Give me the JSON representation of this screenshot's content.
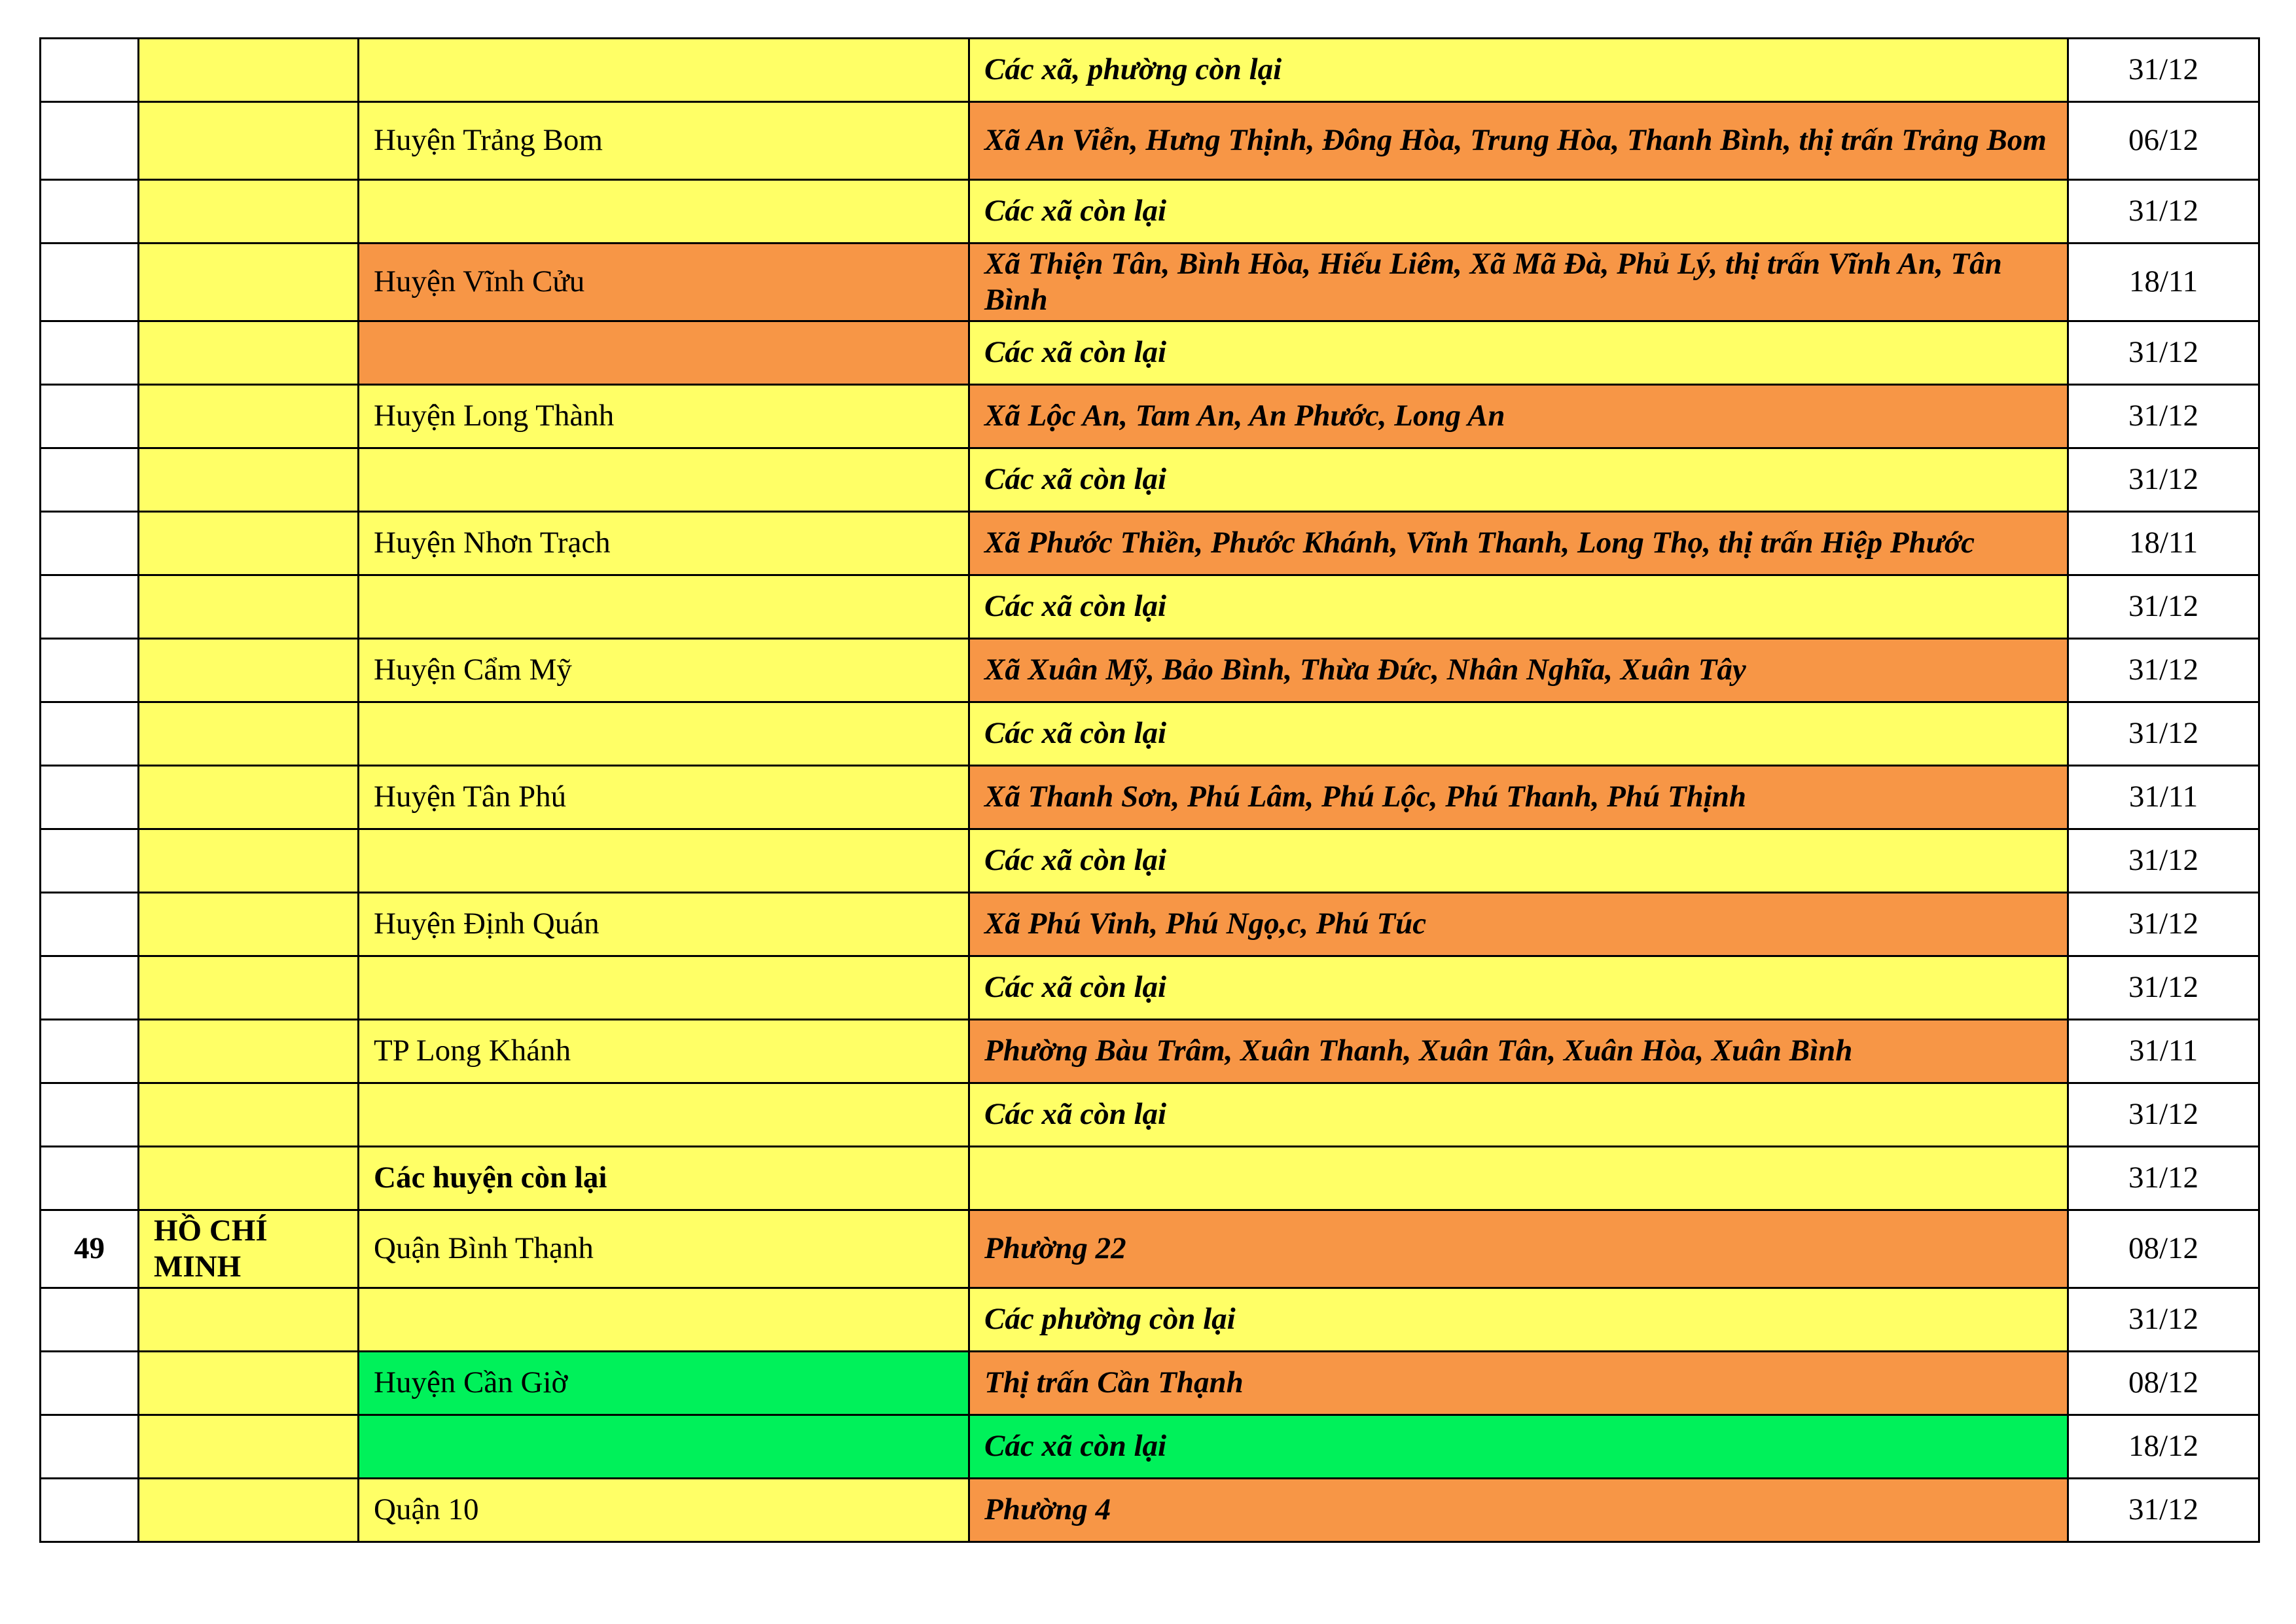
{
  "rows": [
    {
      "no": "",
      "province": "",
      "district": "",
      "areas": "Các xã, phường còn lại",
      "date": "31/12"
    },
    {
      "no": "",
      "province": "",
      "district": "Huyện Trảng Bom",
      "areas": "Xã An Viễn, Hưng Thịnh, Đông Hòa, Trung Hòa, Thanh Bình, thị trấn Trảng Bom",
      "date": "06/12"
    },
    {
      "no": "",
      "province": "",
      "district": "",
      "areas": "Các xã còn lại",
      "date": "31/12"
    },
    {
      "no": "",
      "province": "",
      "district": "Huyện Vĩnh Cửu",
      "areas": "Xã Thiện Tân, Bình Hòa, Hiếu Liêm, Xã Mã Đà, Phủ Lý, thị trấn Vĩnh An, Tân Bình",
      "date": "18/11"
    },
    {
      "no": "",
      "province": "",
      "district": "",
      "areas": "Các xã còn lại",
      "date": "31/12"
    },
    {
      "no": "",
      "province": "",
      "district": "Huyện Long Thành",
      "areas": "Xã Lộc An, Tam An, An Phước, Long An",
      "date": "31/12"
    },
    {
      "no": "",
      "province": "",
      "district": "",
      "areas": "Các xã còn lại",
      "date": "31/12"
    },
    {
      "no": "",
      "province": "",
      "district": "Huyện Nhơn Trạch",
      "areas": "Xã Phước Thiền, Phước Khánh, Vĩnh Thanh, Long Thọ, thị trấn Hiệp Phước",
      "date": "18/11"
    },
    {
      "no": "",
      "province": "",
      "district": "",
      "areas": "Các xã còn lại",
      "date": "31/12"
    },
    {
      "no": "",
      "province": "",
      "district": "Huyện Cẩm Mỹ",
      "areas": "Xã Xuân Mỹ, Bảo Bình, Thừa Đức, Nhân Nghĩa, Xuân Tây",
      "date": "31/12"
    },
    {
      "no": "",
      "province": "",
      "district": "",
      "areas": "Các xã còn lại",
      "date": "31/12"
    },
    {
      "no": "",
      "province": "",
      "district": "Huyện Tân Phú",
      "areas": "Xã Thanh Sơn, Phú Lâm, Phú Lộc, Phú Thanh, Phú Thịnh",
      "date": "31/11"
    },
    {
      "no": "",
      "province": "",
      "district": "",
      "areas": "Các xã còn lại",
      "date": "31/12"
    },
    {
      "no": "",
      "province": "",
      "district": "Huyện Định Quán",
      "areas": "Xã Phú Vinh, Phú Ngọ,c, Phú Túc",
      "date": "31/12"
    },
    {
      "no": "",
      "province": "",
      "district": "",
      "areas": "Các xã còn lại",
      "date": "31/12"
    },
    {
      "no": "",
      "province": "",
      "district": "TP Long Khánh",
      "areas": "Phường Bàu Trâm, Xuân Thanh, Xuân Tân, Xuân Hòa, Xuân Bình",
      "date": "31/11"
    },
    {
      "no": "",
      "province": "",
      "district": "",
      "areas": "Các xã còn lại",
      "date": "31/12"
    },
    {
      "no": "",
      "province": "",
      "district": "Các huyện còn lại",
      "areas": "",
      "date": "31/12"
    },
    {
      "no": "49",
      "province": "HỒ CHÍ MINH",
      "district": "Quận Bình Thạnh",
      "areas": "Phường 22",
      "date": "08/12"
    },
    {
      "no": "",
      "province": "",
      "district": "",
      "areas": "Các phường còn lại",
      "date": "31/12"
    },
    {
      "no": "",
      "province": "",
      "district": "Huyện Cần Giờ",
      "areas": "Thị trấn Cần Thạnh",
      "date": "08/12"
    },
    {
      "no": "",
      "province": "",
      "district": "",
      "areas": "Các xã còn lại",
      "date": "18/12"
    },
    {
      "no": "",
      "province": "",
      "district": "Quận 10",
      "areas": "Phường 4",
      "date": "31/12"
    }
  ],
  "colors": {
    "yellow": "#ffff66",
    "orange": "#f79646",
    "green": "#00f15a",
    "white": "#ffffff"
  }
}
